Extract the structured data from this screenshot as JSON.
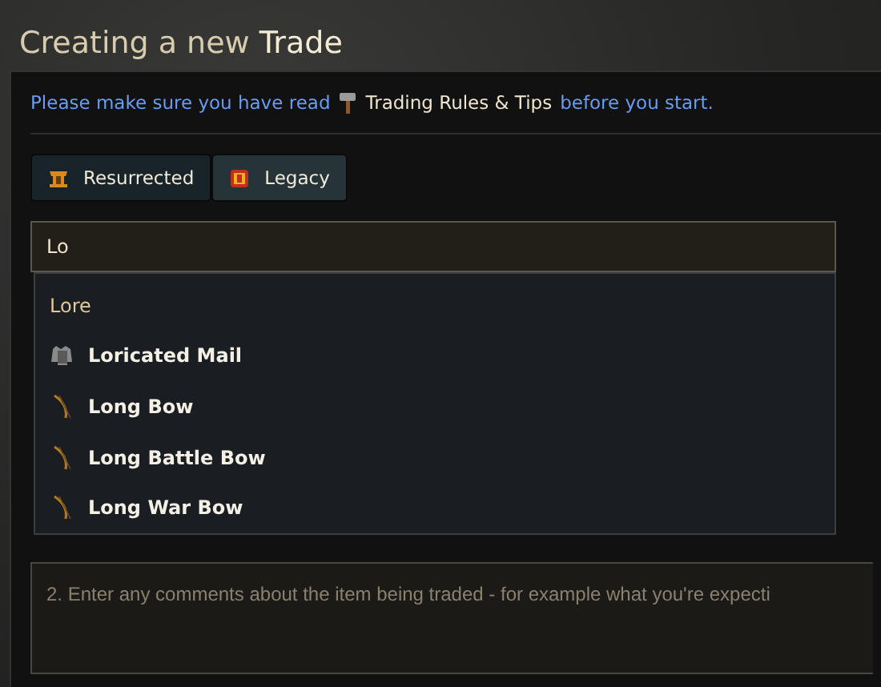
{
  "page_title": {
    "lead": "Creating a new",
    "emphasis": "Trade"
  },
  "notice": {
    "before": "Please make sure you have read",
    "link": "Trading Rules & Tips",
    "after": "before you start."
  },
  "tabs": [
    {
      "label": "Resurrected",
      "selected": true
    },
    {
      "label": "Legacy",
      "selected": false
    }
  ],
  "search": {
    "value": "Lo"
  },
  "results": [
    {
      "kind": "heading",
      "label": "Lore"
    },
    {
      "kind": "armor",
      "label": "Loricated Mail"
    },
    {
      "kind": "bow",
      "label": "Long Bow"
    },
    {
      "kind": "bow",
      "label": "Long Battle Bow"
    },
    {
      "kind": "bow",
      "label": "Long War Bow"
    }
  ],
  "comments": {
    "placeholder": "2. Enter any comments about the item being traded - for example what you're expecti"
  }
}
